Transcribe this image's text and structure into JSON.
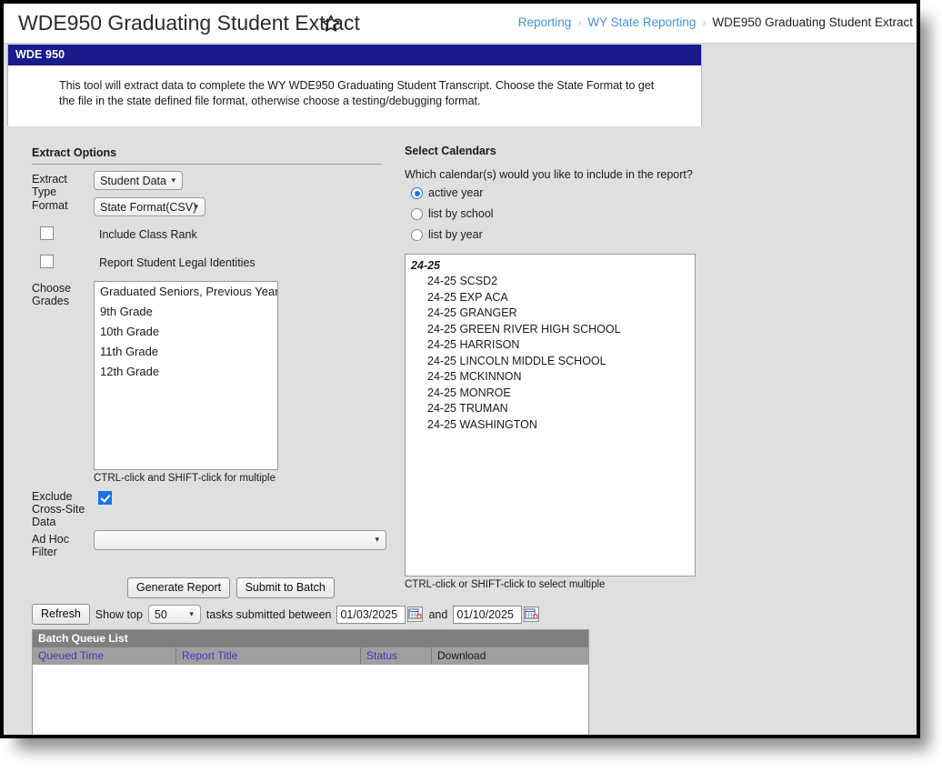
{
  "titlebar": {
    "page_title": "WDE950 Graduating Student Extract",
    "favorite_icon": "star-outline-icon",
    "breadcrumb": {
      "items": [
        "Reporting",
        "WY State Reporting"
      ],
      "current": "WDE950 Graduating Student Extract",
      "separator": "›"
    }
  },
  "info_card": {
    "header": "WDE 950",
    "description": "This tool will extract data to complete the WY WDE950 Graduating Student Transcript. Choose the State Format to get the file in the state defined file format, otherwise choose a testing/debugging format."
  },
  "extract_options": {
    "title": "Extract Options",
    "extract_type": {
      "label": "Extract Type",
      "value": "Student Data",
      "options": [
        "Student Data"
      ]
    },
    "format": {
      "label": "Format",
      "value": "State Format(CSV)",
      "options": [
        "State Format(CSV)"
      ]
    },
    "include_class_rank": {
      "label": "Include Class Rank",
      "checked": false
    },
    "report_legal_identities": {
      "label": "Report Student Legal Identities",
      "checked": false
    },
    "choose_grades": {
      "label": "Choose Grades",
      "options": [
        "Graduated Seniors, Previous Year",
        "9th Grade",
        "10th Grade",
        "11th Grade",
        "12th Grade"
      ],
      "hint": "CTRL-click and SHIFT-click for multiple"
    },
    "exclude_cross_site": {
      "label": "Exclude Cross-Site Data",
      "checked": true
    },
    "ad_hoc_filter": {
      "label": "Ad Hoc Filter",
      "value": "",
      "options": [
        ""
      ]
    },
    "buttons": {
      "generate": "Generate Report",
      "submit_batch": "Submit to Batch"
    }
  },
  "select_calendars": {
    "title": "Select Calendars",
    "question": "Which calendar(s) would you like to include in the report?",
    "modes": [
      {
        "label": "active year",
        "selected": true
      },
      {
        "label": "list by school",
        "selected": false
      },
      {
        "label": "list by year",
        "selected": false
      }
    ],
    "group_label": "24-25",
    "calendars": [
      "24-25 SCSD2",
      "24-25 EXP ACA",
      "24-25 GRANGER",
      "24-25 GREEN RIVER HIGH SCHOOL",
      "24-25 HARRISON",
      "24-25 LINCOLN MIDDLE SCHOOL",
      "24-25 MCKINNON",
      "24-25 MONROE",
      "24-25 TRUMAN",
      "24-25 WASHINGTON"
    ],
    "hint": "CTRL-click or SHIFT-click to select multiple"
  },
  "batch_queue": {
    "refresh_label": "Refresh",
    "show_top_label": "Show top",
    "show_top_value": "50",
    "show_top_options": [
      "50"
    ],
    "between_label": "tasks submitted between",
    "and_label": "and",
    "date_from": "01/03/2025",
    "date_to": "01/10/2025",
    "calendar_icon": "calendar-picker-icon",
    "table_title": "Batch Queue List",
    "columns": [
      "Queued Time",
      "Report Title",
      "Status",
      "Download"
    ],
    "rows": []
  },
  "colors": {
    "card_header": "#1a1a8c",
    "link": "#4a90d9",
    "checkbox_checked": "#1a73e8",
    "table_title_bg": "#7f7f7f",
    "table_head_bg": "#9f9f9f",
    "column_link": "#4b2fbf"
  }
}
